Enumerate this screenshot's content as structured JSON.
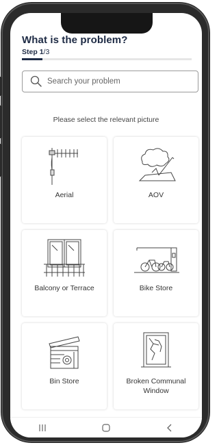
{
  "header": {
    "title": "What is the problem?",
    "step_label": "Step",
    "step_current": "1",
    "step_total": "/3",
    "progress_fraction": 0.12
  },
  "search": {
    "placeholder": "Search your problem"
  },
  "instruction": "Please select the relevant picture",
  "categories": [
    {
      "label": "Aerial",
      "icon": "aerial-icon"
    },
    {
      "label": "AOV",
      "icon": "aov-icon"
    },
    {
      "label": "Balcony or Terrace",
      "icon": "balcony-icon"
    },
    {
      "label": "Bike Store",
      "icon": "bike-store-icon"
    },
    {
      "label": "Bin Store",
      "icon": "bin-store-icon"
    },
    {
      "label": "Broken Communal Window",
      "icon": "broken-window-icon"
    }
  ],
  "navbar": [
    {
      "icon": "recent-apps-icon"
    },
    {
      "icon": "home-icon"
    },
    {
      "icon": "back-icon"
    }
  ],
  "colors": {
    "heading": "#1d2a44",
    "border": "#9a9a9a"
  }
}
